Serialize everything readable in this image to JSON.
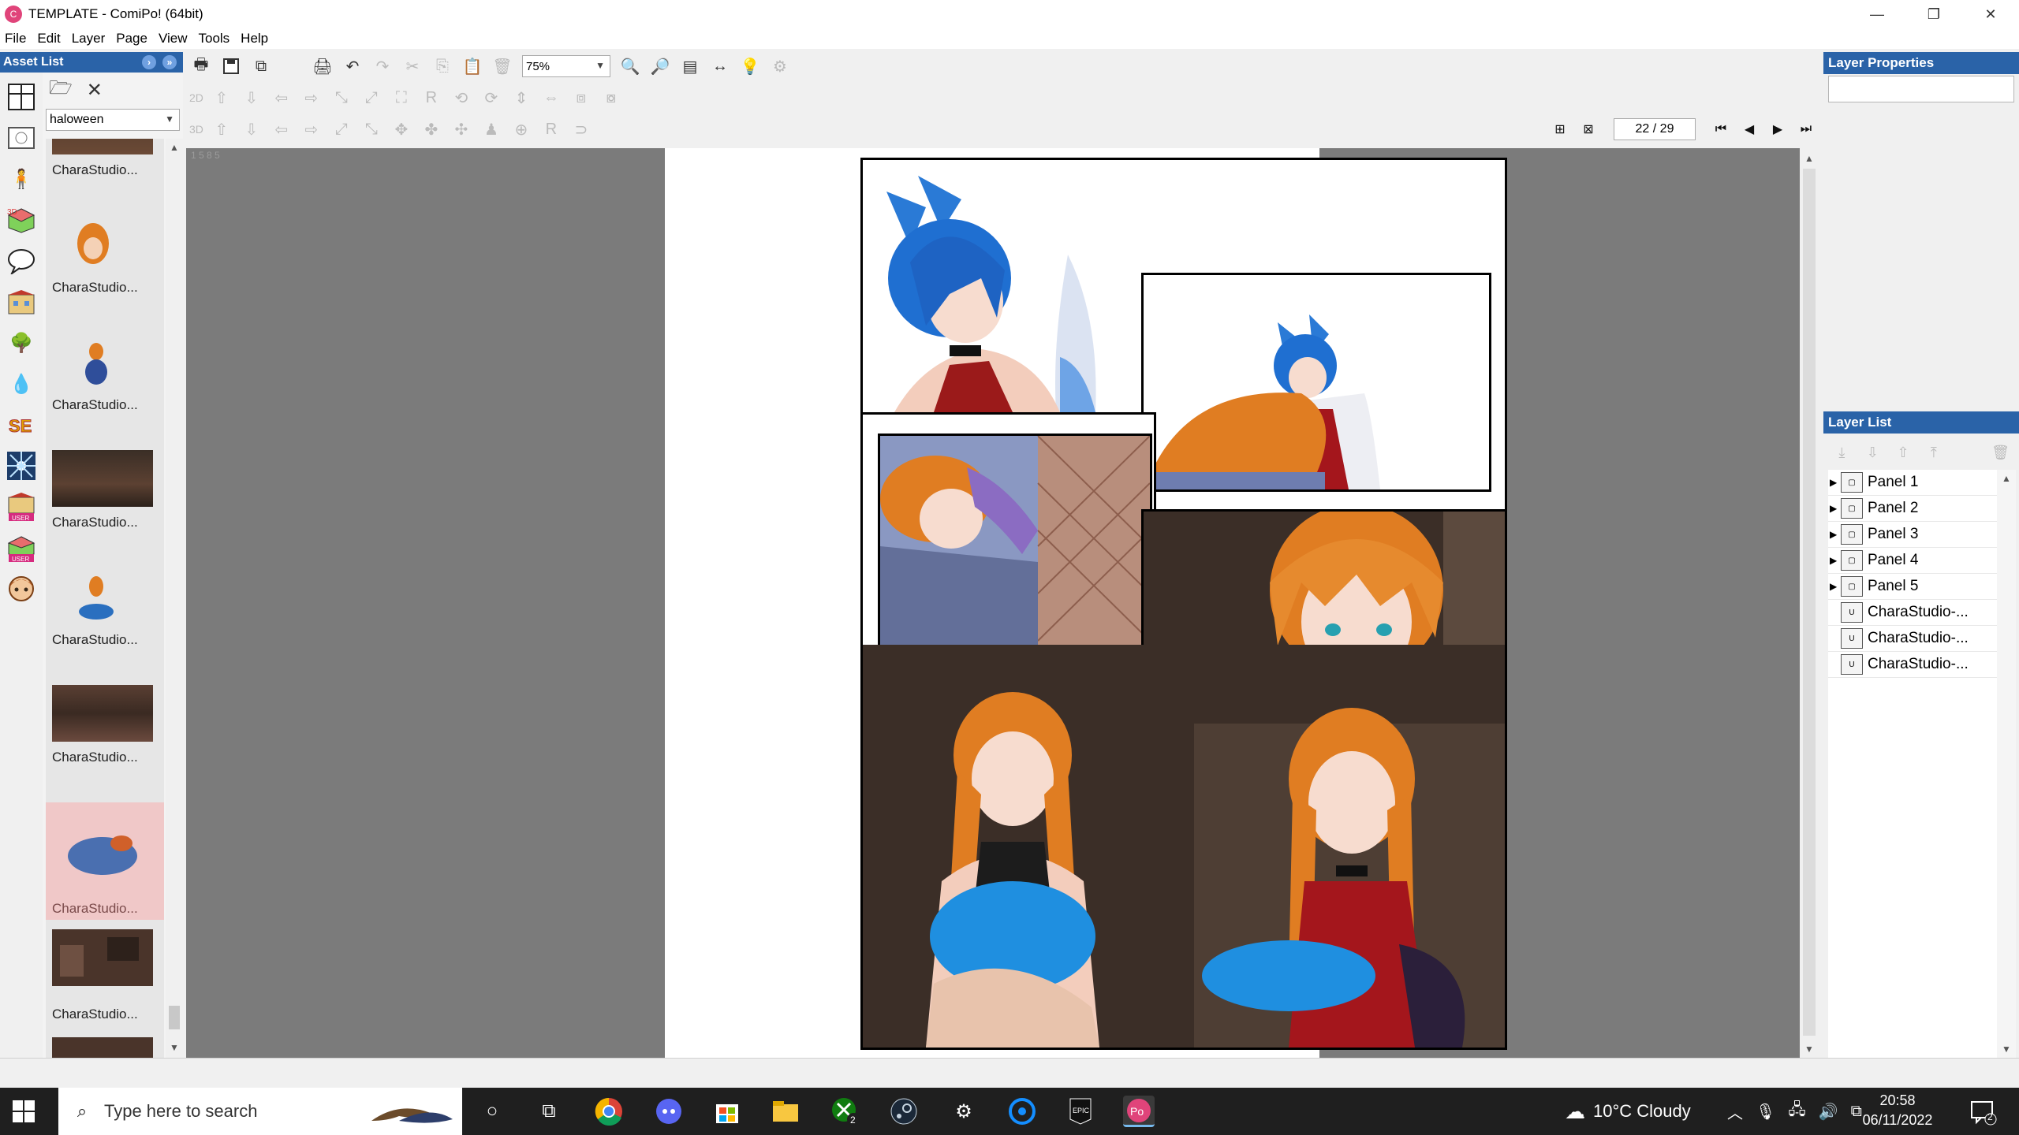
{
  "window": {
    "title": "TEMPLATE - ComiPo! (64bit)",
    "controls": {
      "minimize": "—",
      "restore": "❐",
      "close": "✕"
    }
  },
  "menu": [
    "File",
    "Edit",
    "Layer",
    "Page",
    "View",
    "Tools",
    "Help"
  ],
  "asset_panel": {
    "title": "Asset List",
    "folder_select": "haloween",
    "items": [
      {
        "label": "CharaStudio...",
        "selected": false
      },
      {
        "label": "CharaStudio...",
        "selected": false
      },
      {
        "label": "CharaStudio...",
        "selected": false
      },
      {
        "label": "CharaStudio...",
        "selected": false
      },
      {
        "label": "CharaStudio...",
        "selected": false
      },
      {
        "label": "CharaStudio...",
        "selected": false
      },
      {
        "label": "CharaStudio...",
        "selected": true
      },
      {
        "label": "CharaStudio...",
        "selected": false
      }
    ]
  },
  "toolbar": {
    "zoom": "75%",
    "row2_label": "2D",
    "row3_label": "3D"
  },
  "pager": {
    "page_indicator": "22 / 29"
  },
  "canvas": {
    "ruler_mark": "1 5 8 5"
  },
  "layer_properties": {
    "title": "Layer Properties"
  },
  "layer_list": {
    "title": "Layer List",
    "layers": [
      {
        "name": "Panel 1",
        "type": "panel"
      },
      {
        "name": "Panel 2",
        "type": "panel"
      },
      {
        "name": "Panel 3",
        "type": "panel"
      },
      {
        "name": "Panel 4",
        "type": "panel"
      },
      {
        "name": "Panel 5",
        "type": "panel"
      },
      {
        "name": "CharaStudio-...",
        "type": "user"
      },
      {
        "name": "CharaStudio-...",
        "type": "user"
      },
      {
        "name": "CharaStudio-...",
        "type": "user"
      }
    ]
  },
  "taskbar": {
    "search_placeholder": "Type here to search",
    "weather": "10°C  Cloudy",
    "time": "20:58",
    "date": "06/11/2022",
    "notification_count": "2",
    "xbox_badge": "2"
  },
  "colors": {
    "header_blue": "#2a63a8",
    "canvas_gray": "#7b7b7b",
    "taskbar": "#1f1f1f"
  }
}
